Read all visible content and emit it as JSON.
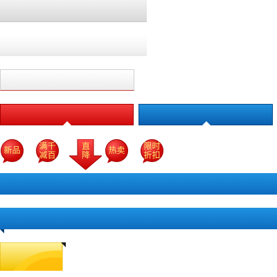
{
  "badges": {
    "new": "新品",
    "discount_line1": "满千",
    "discount_line2": "减百",
    "price_drop_line1": "直",
    "price_drop_line2": "降",
    "hot": "热卖",
    "limited_line1": "限时",
    "limited_line2": "折扣"
  },
  "colors": {
    "red": "#d10b0b",
    "blue": "#0f6cbf",
    "yellow": "#ffd21a",
    "badge_text": "#ffe46b"
  }
}
